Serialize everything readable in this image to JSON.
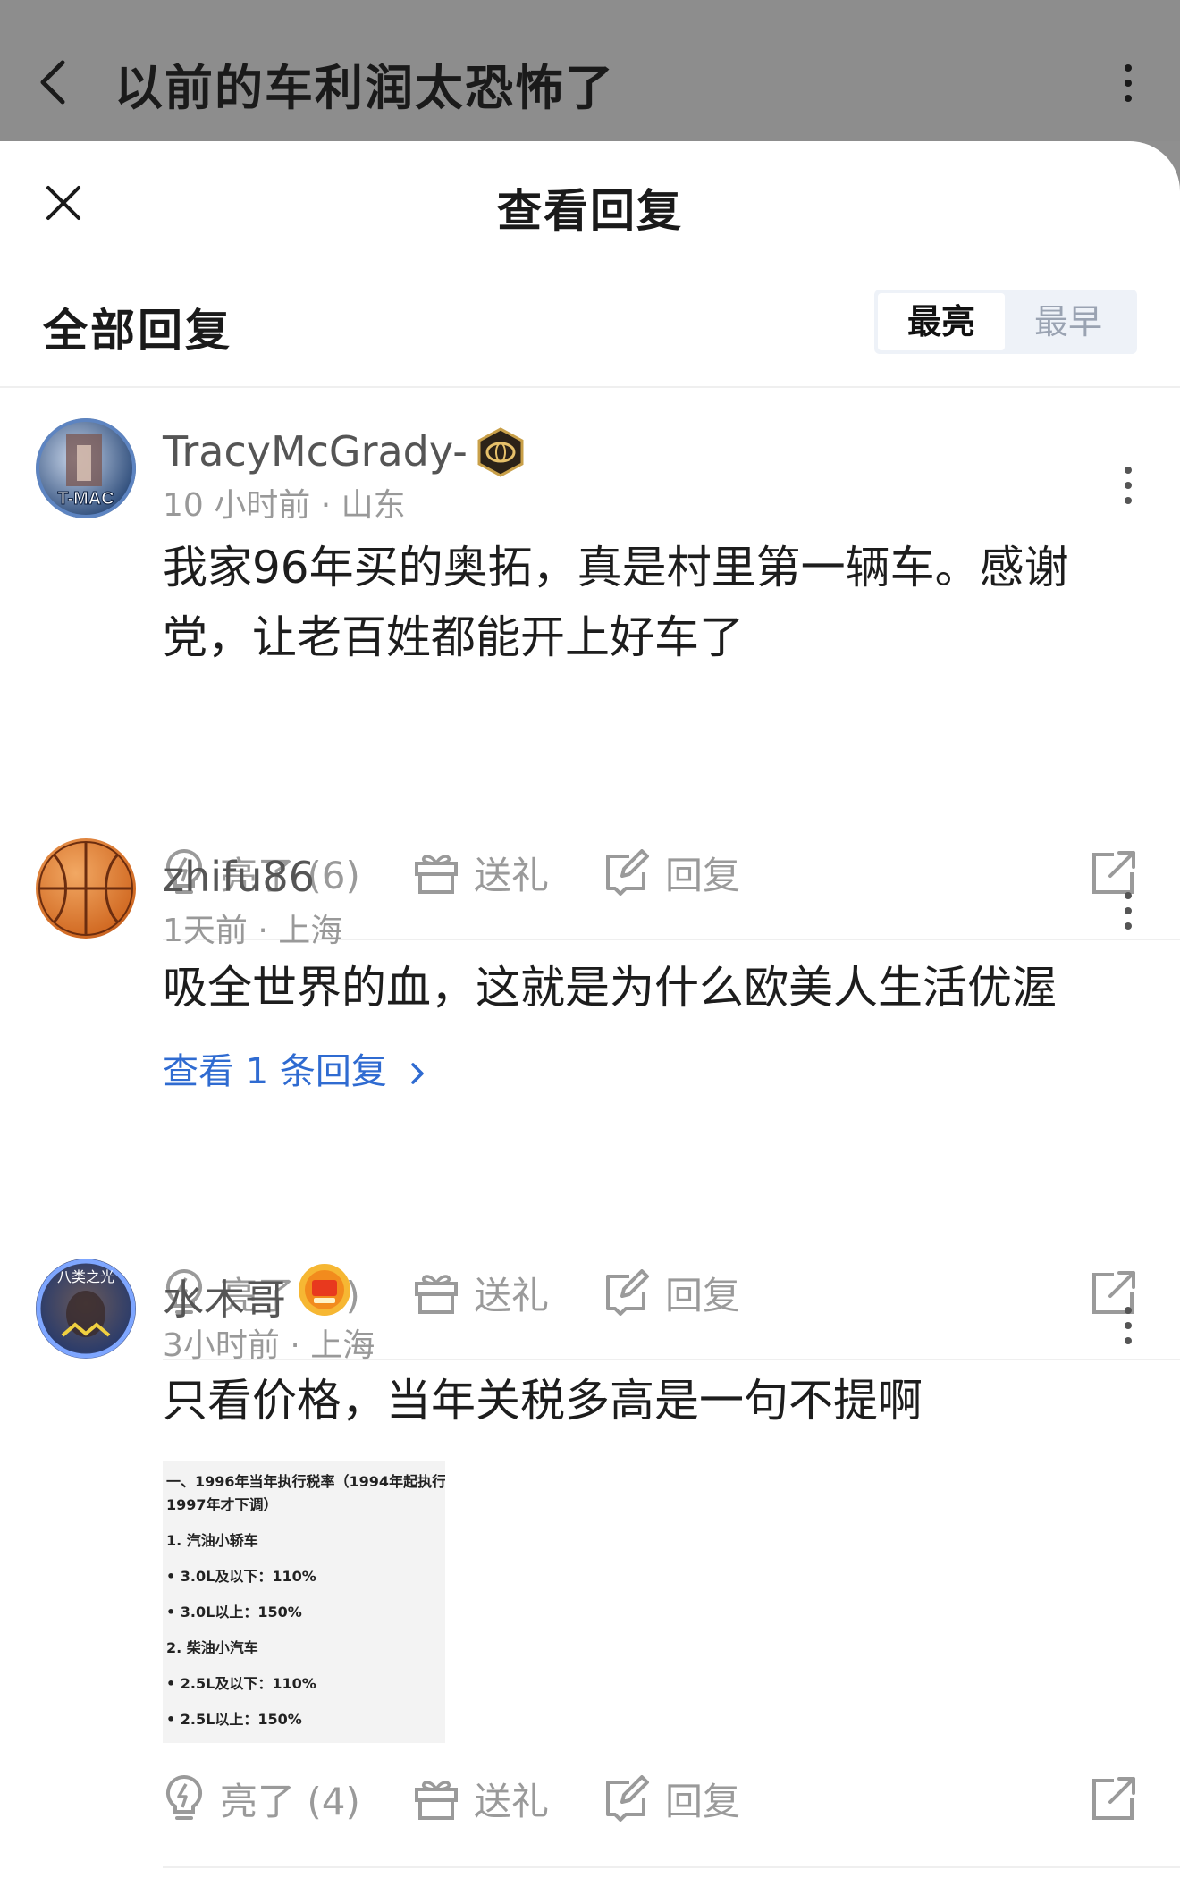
{
  "header": {
    "title": "以前的车利润太恐怖了"
  },
  "sheet": {
    "title": "查看回复",
    "section_title": "全部回复",
    "sort_options": [
      "最亮",
      "最早"
    ]
  },
  "comments": [
    {
      "username": "TracyMcGrady-",
      "time": "10 小时前",
      "location": "山东",
      "text": "我家96年买的奥拓，真是村里第一辆车。感谢党，让老百姓都能开上好车了",
      "avatar_text": "T-MAC",
      "likes_label": "亮了 (6)",
      "gift_label": "送礼",
      "reply_label": "回复"
    },
    {
      "username": "zhifu86",
      "time": "1天前",
      "location": "上海",
      "text": "吸全世界的血，这就是为什么欧美人生活优渥",
      "view_replies": "查看 1 条回复",
      "likes_label": "亮了 (6)",
      "gift_label": "送礼",
      "reply_label": "回复"
    },
    {
      "username": "水木哥",
      "time": "3小时前",
      "location": "上海",
      "text": "只看价格，当年关税多高是一句不提啊",
      "avatar_text": "八类之光",
      "image_lines": [
        "一、1996年当年执行税率（1994年起执行，",
        "1997年才下调）",
        "1. 汽油小轿车",
        "• 3.0L及以下：110%",
        "• 3.0L以上：150%",
        "2. 柴油小汽车",
        "• 2.5L及以下：110%",
        "• 2.5L以上：150%"
      ],
      "likes_label": "亮了 (4)",
      "gift_label": "送礼",
      "reply_label": "回复"
    }
  ],
  "meta_separator": "·",
  "colors": {
    "accent_blue": "#2f6bd1",
    "icon_gray": "#9a9a9a"
  }
}
